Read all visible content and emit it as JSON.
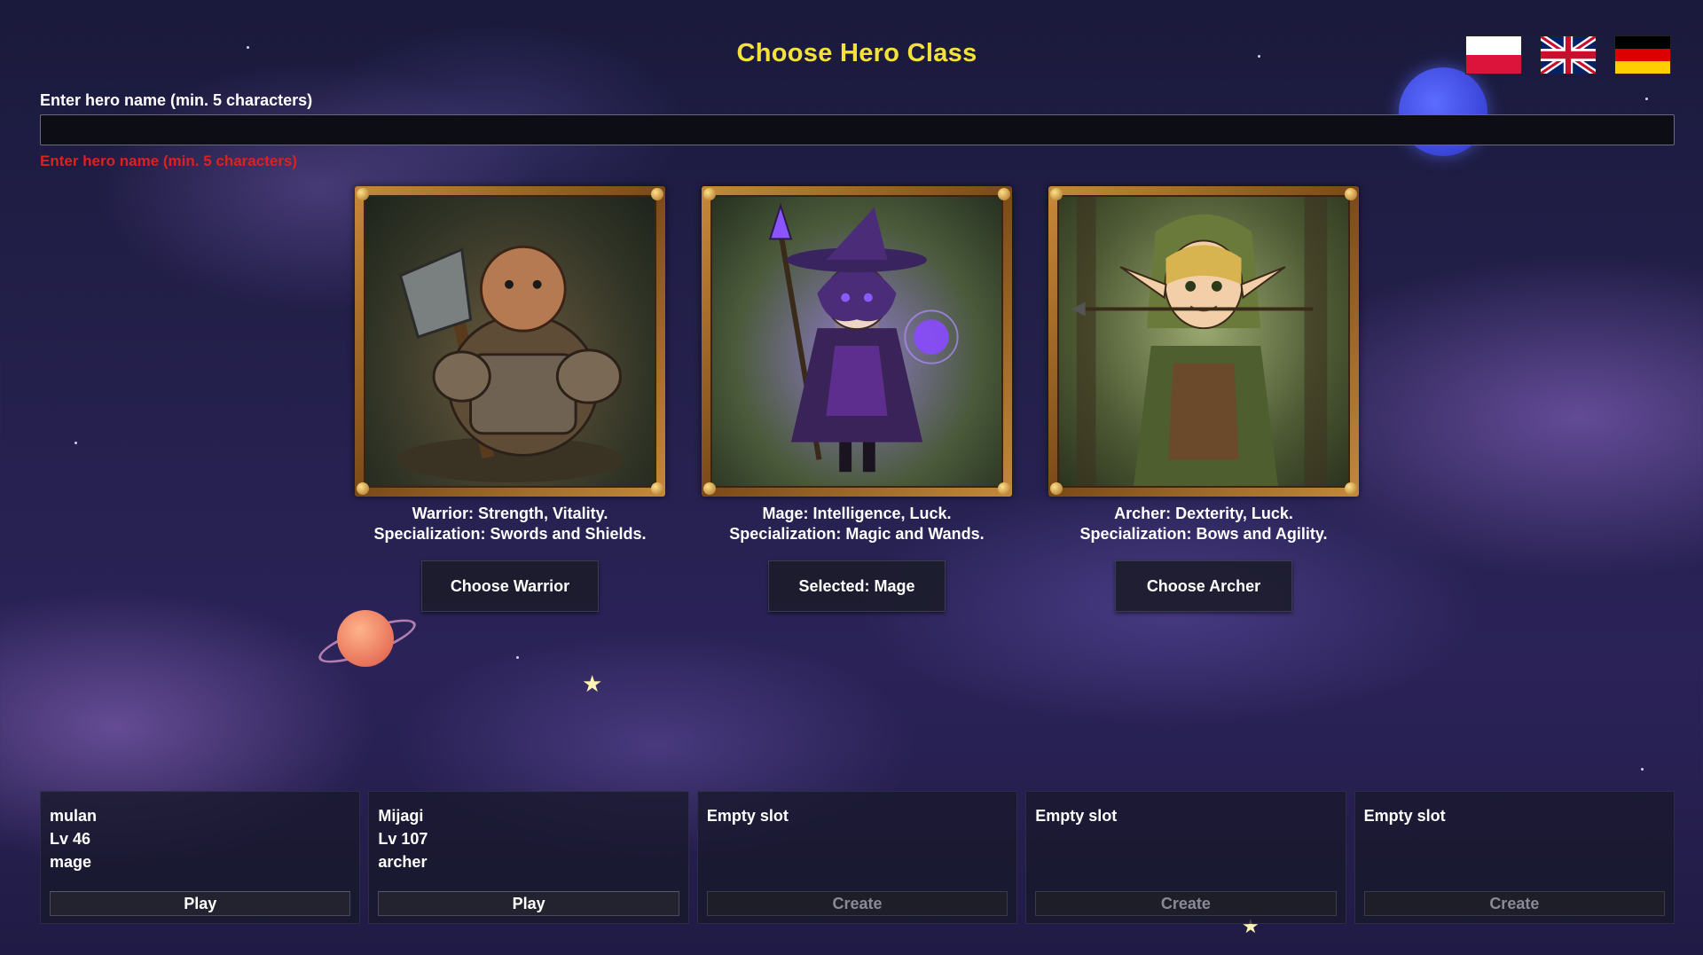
{
  "header": {
    "title": "Choose Hero Class"
  },
  "languages": [
    {
      "code": "pl",
      "icon": "poland-flag-icon"
    },
    {
      "code": "en",
      "icon": "uk-flag-icon"
    },
    {
      "code": "de",
      "icon": "germany-flag-icon"
    }
  ],
  "name_field": {
    "label": "Enter hero name (min. 5 characters)",
    "value": "",
    "error": "Enter hero name (min. 5 characters)"
  },
  "classes": [
    {
      "id": "warrior",
      "portrait": "warrior-portrait",
      "desc_line1": "Warrior: Strength, Vitality.",
      "desc_line2": "Specialization: Swords and Shields.",
      "button": "Choose Warrior"
    },
    {
      "id": "mage",
      "portrait": "mage-portrait",
      "desc_line1": "Mage: Intelligence, Luck.",
      "desc_line2": "Specialization: Magic and Wands.",
      "button": "Selected: Mage"
    },
    {
      "id": "archer",
      "portrait": "archer-portrait",
      "desc_line1": "Archer: Dexterity, Luck.",
      "desc_line2": "Specialization: Bows and Agility.",
      "button": "Choose Archer"
    }
  ],
  "slots": [
    {
      "name": "mulan",
      "level": "Lv 46",
      "class": "mage",
      "button": "Play"
    },
    {
      "name": "Mijagi",
      "level": "Lv 107",
      "class": "archer",
      "button": "Play"
    },
    {
      "name": "Empty slot",
      "button": "Create"
    },
    {
      "name": "Empty slot",
      "button": "Create"
    },
    {
      "name": "Empty slot",
      "button": "Create"
    }
  ],
  "colors": {
    "title": "#f4e23a",
    "error": "#e0201e",
    "frame": "#c48a3a"
  }
}
